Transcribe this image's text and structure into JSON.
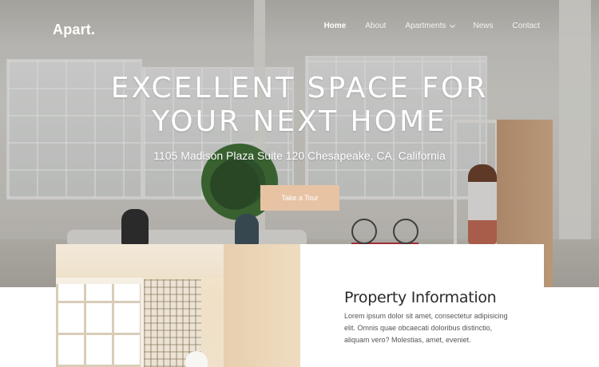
{
  "brand": "Apart.",
  "nav": {
    "items": [
      {
        "label": "Home"
      },
      {
        "label": "About"
      },
      {
        "label": "Apartments"
      },
      {
        "label": "News"
      },
      {
        "label": "Contact"
      }
    ]
  },
  "hero": {
    "headline_line1": "EXCELLENT SPACE FOR",
    "headline_line2": "YOUR NEXT HOME",
    "address": "1105 Madison Plaza Suite 120 Chesapeake, CA, California",
    "cta_label": "Take a Tour"
  },
  "property": {
    "title": "Property Information",
    "description": "Lorem ipsum dolor sit amet, consectetur adipisicing elit. Omnis quae obcaecati doloribus distinctio, aliquam vero? Molestias, amet, eveniet."
  },
  "colors": {
    "accent": "#e7c3a4",
    "text_dark": "#2a2a2a",
    "text_body": "#555555"
  }
}
